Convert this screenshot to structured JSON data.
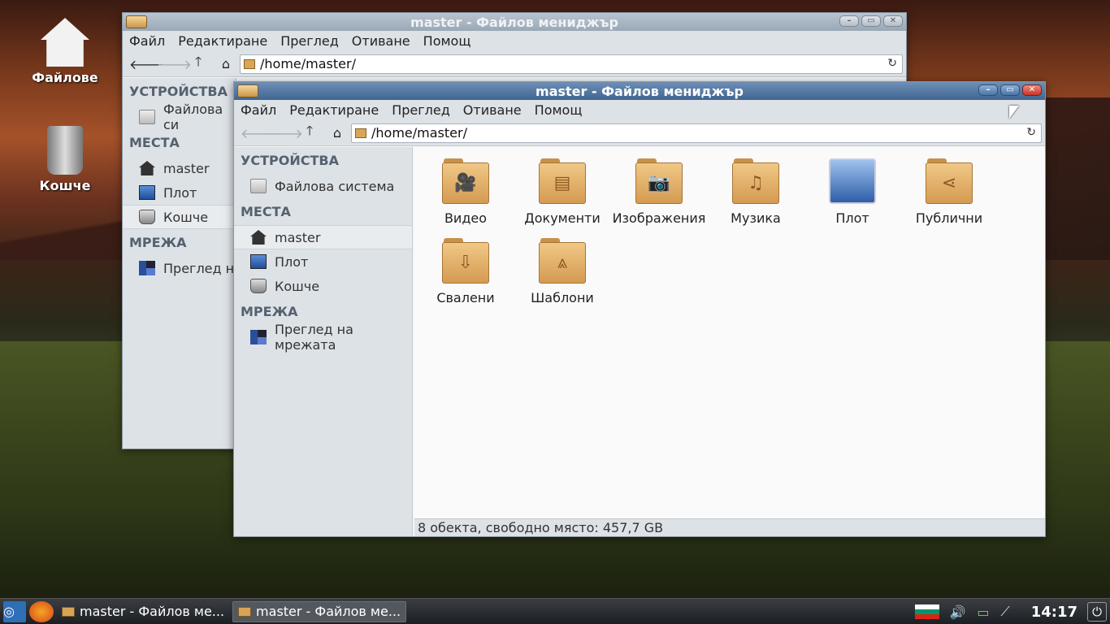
{
  "desktop": {
    "icons": [
      {
        "label": "Файлове",
        "icon": "home-icon"
      },
      {
        "label": "Кошче",
        "icon": "trash-icon"
      }
    ]
  },
  "back_window": {
    "title": "master - Файлов мениджър",
    "menu": [
      "Файл",
      "Редактиране",
      "Преглед",
      "Отиване",
      "Помощ"
    ],
    "path": "/home/master/",
    "sidebar": {
      "devices_head": "УСТРОЙСТВА",
      "devices": [
        "Файлова си"
      ],
      "places_head": "МЕСТА",
      "places": [
        "master",
        "Плот",
        "Кошче"
      ],
      "network_head": "МРЕЖА",
      "network": [
        "Преглед на"
      ]
    }
  },
  "front_window": {
    "title": "master - Файлов мениджър",
    "menu": [
      "Файл",
      "Редактиране",
      "Преглед",
      "Отиване",
      "Помощ"
    ],
    "path": "/home/master/",
    "sidebar": {
      "devices_head": "УСТРОЙСТВА",
      "devices": [
        "Файлова система"
      ],
      "places_head": "МЕСТА",
      "places": [
        "master",
        "Плот",
        "Кошче"
      ],
      "network_head": "МРЕЖА",
      "network": [
        "Преглед на мрежата"
      ]
    },
    "files": [
      {
        "label": "Видео",
        "icon": "video-folder-icon",
        "glyph": "🎥"
      },
      {
        "label": "Документи",
        "icon": "documents-folder-icon",
        "glyph": "▤"
      },
      {
        "label": "Изображения",
        "icon": "pictures-folder-icon",
        "glyph": "📷"
      },
      {
        "label": "Музика",
        "icon": "music-folder-icon",
        "glyph": "♫"
      },
      {
        "label": "Плот",
        "icon": "desktop-icon",
        "glyph": ""
      },
      {
        "label": "Публични",
        "icon": "public-folder-icon",
        "glyph": "⋖"
      },
      {
        "label": "Свалени",
        "icon": "downloads-folder-icon",
        "glyph": "⇩"
      },
      {
        "label": "Шаблони",
        "icon": "templates-folder-icon",
        "glyph": "⩓"
      }
    ],
    "status": "8 обекта, свободно място: 457,7 GB"
  },
  "taskbar": {
    "tasks": [
      "master - Файлов ме...",
      "master - Файлов ме..."
    ],
    "clock": "14:17"
  },
  "colors": {
    "accent": "#3f6590",
    "folder": "#d49a52"
  }
}
